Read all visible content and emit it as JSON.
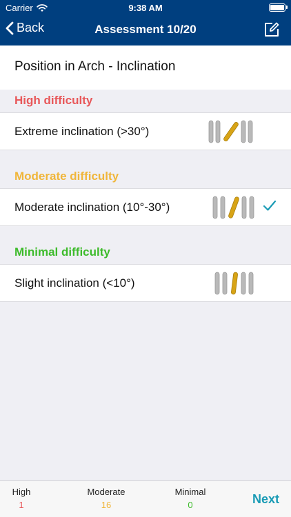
{
  "status_bar": {
    "carrier": "Carrier",
    "time": "9:38 AM"
  },
  "nav": {
    "back_label": "Back",
    "title": "Assessment 10/20"
  },
  "section_title": "Position in Arch - Inclination",
  "groups": [
    {
      "label": "High difficulty",
      "color": "#e8585a",
      "option": {
        "label": "Extreme inclination (>30°)",
        "selected": false
      }
    },
    {
      "label": "Moderate difficulty",
      "color": "#f0b63a",
      "option": {
        "label": "Moderate inclination (10°-30°)",
        "selected": true
      }
    },
    {
      "label": "Minimal difficulty",
      "color": "#3dbb2b",
      "option": {
        "label": "Slight inclination (<10°)",
        "selected": false
      }
    }
  ],
  "counts": [
    {
      "label": "High",
      "value": "1",
      "color": "#e8585a"
    },
    {
      "label": "Moderate",
      "value": "16",
      "color": "#f0b63a"
    },
    {
      "label": "Minimal",
      "value": "0",
      "color": "#3dbb2b"
    }
  ],
  "next_label": "Next",
  "colors": {
    "nav_bg": "#003f7f",
    "accent": "#1a9bb5",
    "tooth_gray": "#b9b9b9",
    "tooth_gold": "#d8a416"
  },
  "icons": {
    "back": "chevron-left-icon",
    "edit": "edit-square-icon",
    "check": "checkmark-icon",
    "wifi": "wifi-icon",
    "battery": "battery-icon"
  }
}
